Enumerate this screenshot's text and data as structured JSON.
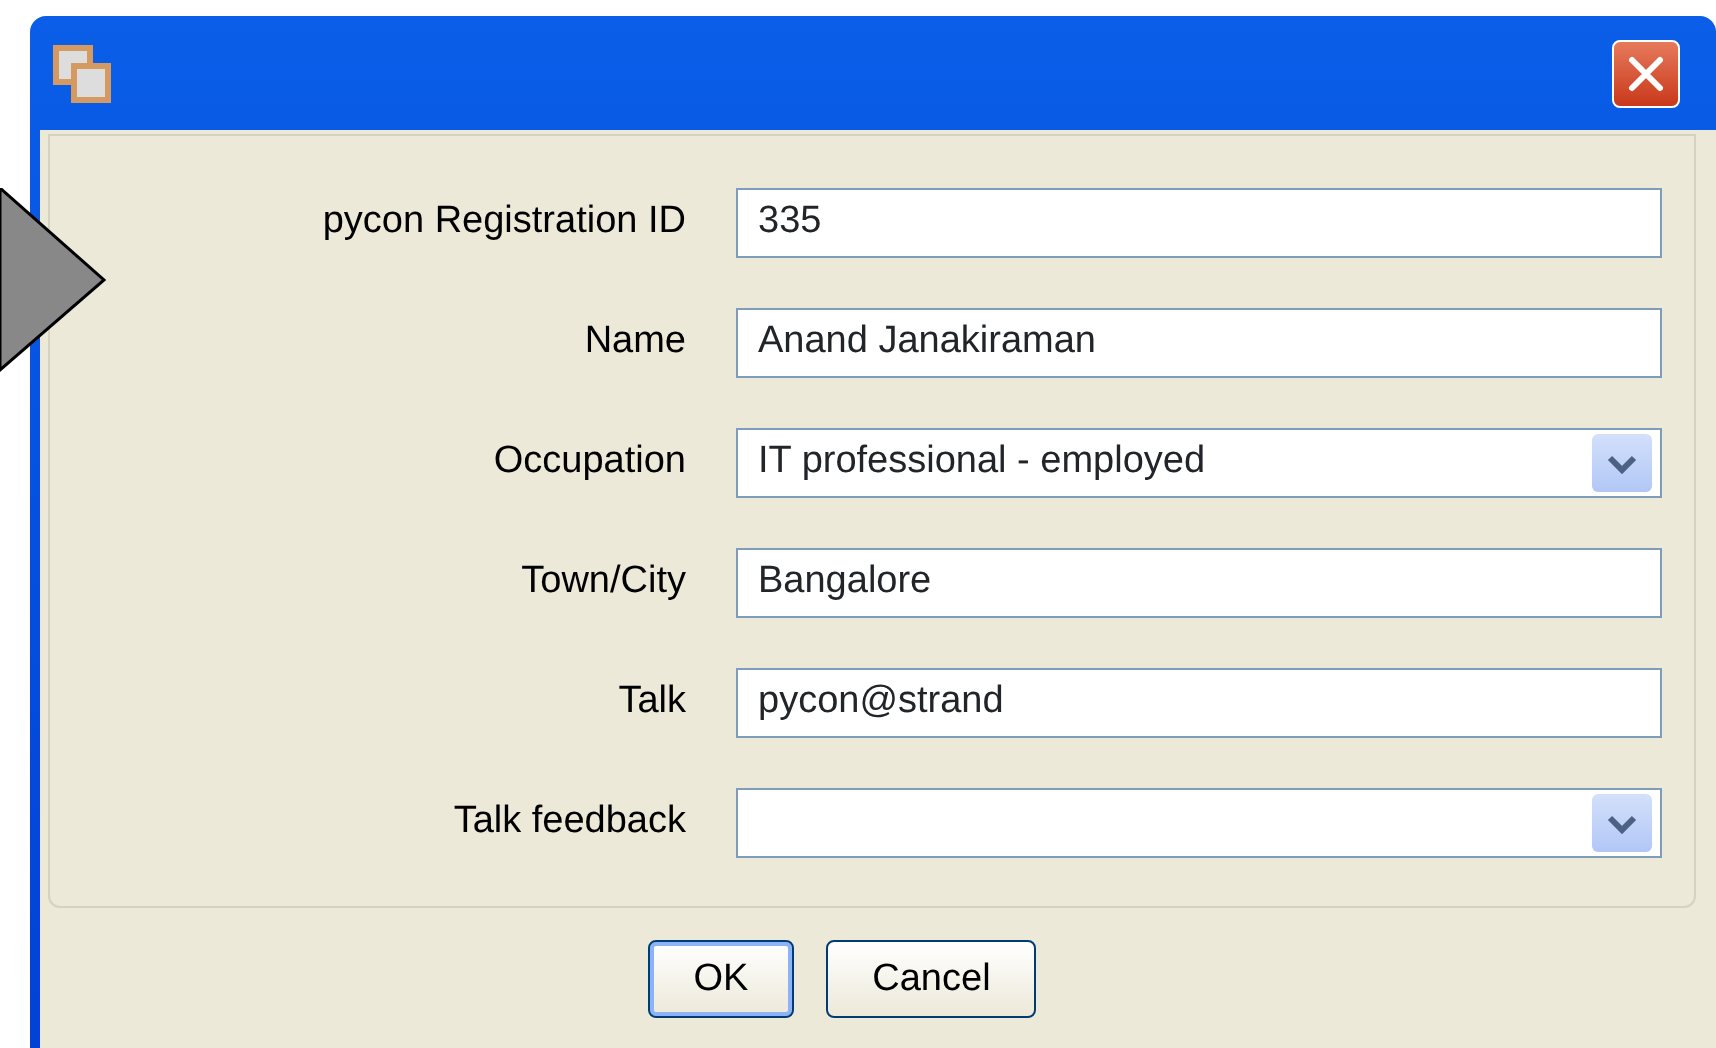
{
  "fields": [
    {
      "label": "pycon Registration ID",
      "kind": "text",
      "value": "335"
    },
    {
      "label": "Name",
      "kind": "text",
      "value": "Anand Janakiraman"
    },
    {
      "label": "Occupation",
      "kind": "combo",
      "value": "IT professional - employed"
    },
    {
      "label": "Town/City",
      "kind": "text",
      "value": "Bangalore"
    },
    {
      "label": "Talk",
      "kind": "text",
      "value": "pycon@strand"
    },
    {
      "label": "Talk feedback",
      "kind": "combo"
    }
  ],
  "buttons": [
    {
      "label": "OK",
      "default": true
    },
    {
      "label": "Cancel",
      "default": false
    }
  ]
}
